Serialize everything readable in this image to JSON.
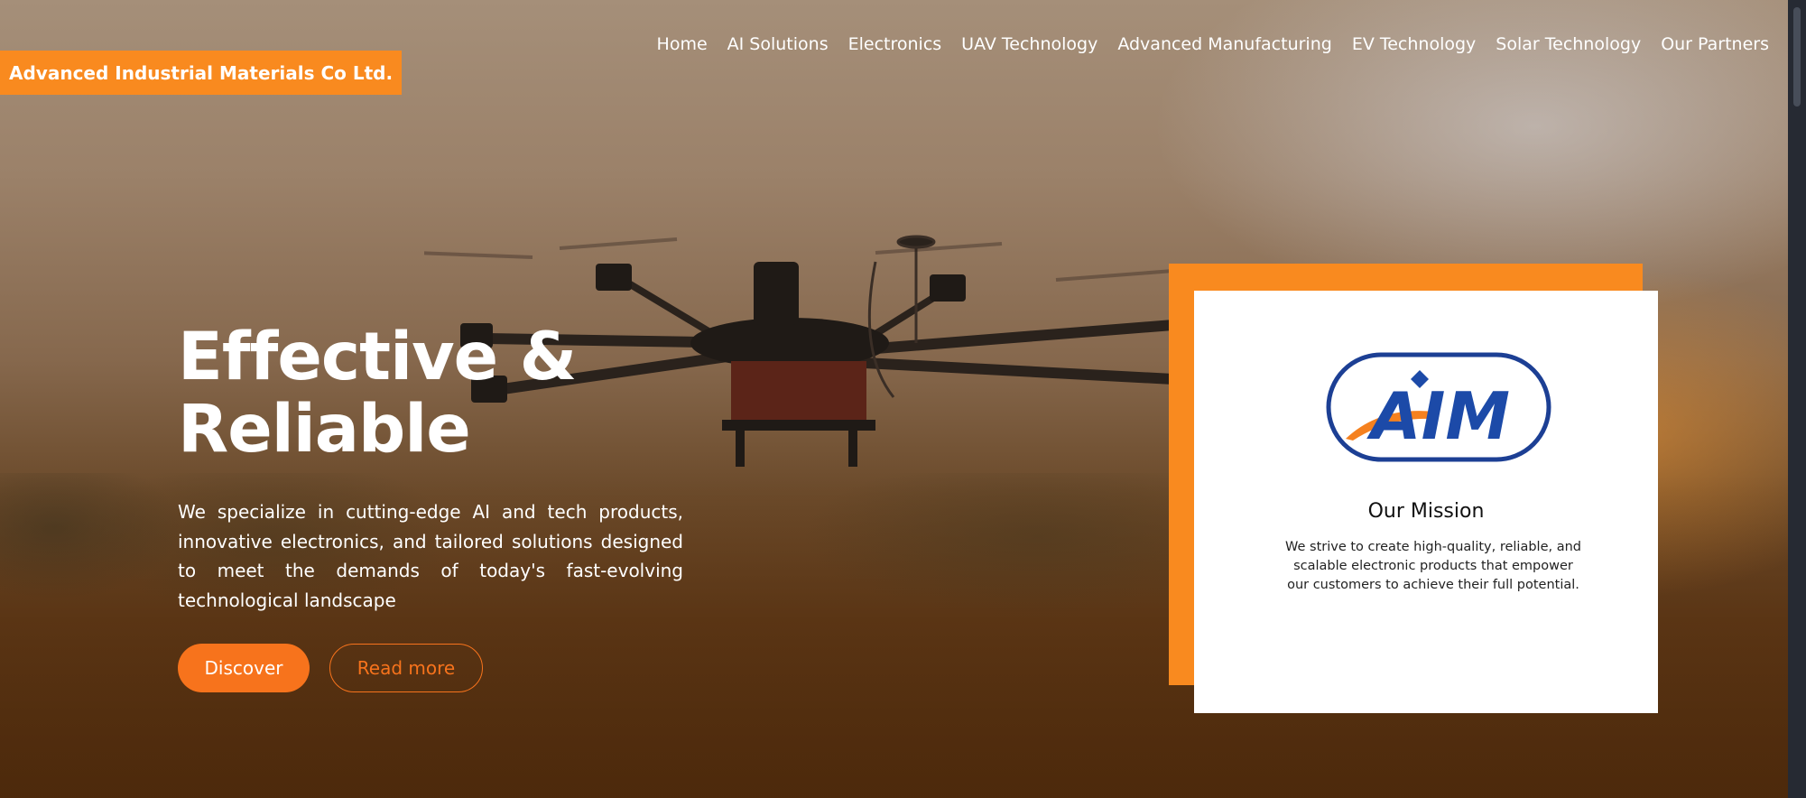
{
  "brand": {
    "name": "Advanced Industrial Materials Co Ltd."
  },
  "nav": {
    "items": [
      "Home",
      "AI Solutions",
      "Electronics",
      "UAV Technology",
      "Advanced Manufacturing",
      "EV Technology",
      "Solar Technology",
      "Our Partners"
    ]
  },
  "hero": {
    "headline": "Effective & Reliable",
    "description": "We specialize in cutting-edge AI and tech products, innovative electronics, and tailored solutions designed to meet the demands of today's fast-evolving technological landscape",
    "discover_label": "Discover",
    "read_more_label": "Read more"
  },
  "mission": {
    "logo_text": "AIM",
    "title": "Our Mission",
    "text": "We strive to create high-quality, reliable, and scalable electronic products that empower our customers to achieve their full potential."
  },
  "colors": {
    "accent": "#f98a1f",
    "button": "#f7731c",
    "logo_blue": "#1c4aa8",
    "text_light": "#ffffff"
  },
  "icons": {
    "hero_image": "drone-illustration",
    "logo": "aim-logo"
  }
}
